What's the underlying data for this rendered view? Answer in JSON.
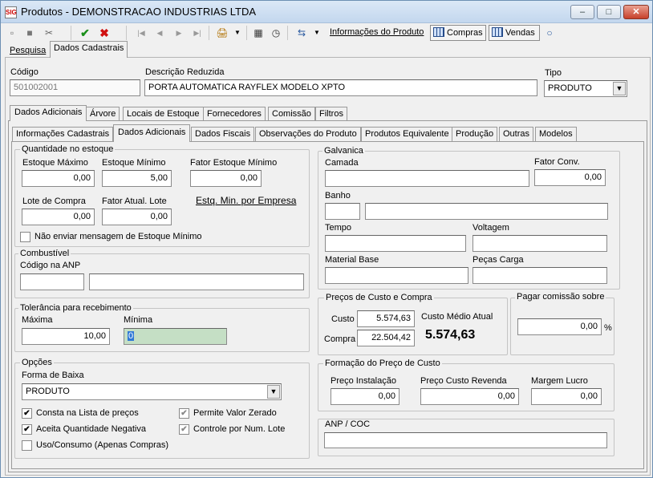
{
  "window": {
    "title": "Produtos - DEMONSTRACAO INDUSTRIAS LTDA",
    "icon_text": "SIG",
    "min": "–",
    "max": "□",
    "close": "✕"
  },
  "toolbar": {
    "icons": [
      "new-icon",
      "save-icon",
      "delete-icon",
      "confirm-icon",
      "cancel-icon",
      "first-icon",
      "prev-icon",
      "next-icon",
      "last-icon",
      "print-icon",
      "calculator-icon",
      "history-icon",
      "export-icon",
      "status-circle-icon"
    ],
    "glyphs": {
      "new": "▫",
      "save": "■",
      "delete": "✂",
      "confirm": "✔",
      "cancel": "✖",
      "first": "|◀",
      "prev": "◀",
      "next": "▶",
      "last": "▶|",
      "print": "🖨",
      "dropdown": "▼",
      "calc": "▦",
      "history": "◷",
      "export": "⇆",
      "circle": "○"
    },
    "info_link": "Informações do Produto",
    "compras": "Compras",
    "vendas": "Vendas",
    "colors": {
      "confirm": "#1a8f1a",
      "cancel": "#d01010"
    }
  },
  "top_tabs": [
    "Pesquisa",
    "Dados Cadastrais"
  ],
  "header": {
    "codigo_label": "Código",
    "codigo_value": "501002001",
    "descricao_label": "Descrição Reduzida",
    "descricao_value": "PORTA AUTOMATICA RAYFLEX MODELO XPTO",
    "tipo_label": "Tipo",
    "tipo_value": "PRODUTO"
  },
  "section_tabs": [
    "Dados Adicionais",
    "Árvore",
    "Locais de Estoque",
    "Fornecedores",
    "Comissão",
    "Filtros"
  ],
  "sub_tabs": [
    "Informações Cadastrais",
    "Dados Adicionais",
    "Dados Fiscais",
    "Observações do Produto",
    "Produtos Equivalente",
    "Produção",
    "Outras",
    "Modelos"
  ],
  "estoque": {
    "title": "Quantidade no estoque",
    "max_label": "Estoque Máximo",
    "max_value": "0,00",
    "min_label": "Estoque Mínimo",
    "min_value": "5,00",
    "fator_min_label": "Fator Estoque Mínimo",
    "fator_min_value": "0,00",
    "lote_label": "Lote de Compra",
    "lote_value": "0,00",
    "fator_lote_label": "Fator Atual. Lote",
    "fator_lote_value": "0,00",
    "empresa_link": "Estq. Min. por Empresa",
    "nao_enviar_label": "Não enviar mensagem de Estoque Mínimo"
  },
  "combustivel": {
    "title": "Combustível",
    "anp_label": "Código na ANP",
    "anp_value": "",
    "anp_desc": ""
  },
  "tolerancia": {
    "title": "Tolerância para recebimento",
    "max_label": "Máxima",
    "max_value": "10,00",
    "min_label": "Mínima",
    "min_value": "0"
  },
  "opcoes": {
    "title": "Opções",
    "forma_label": "Forma de Baixa",
    "forma_value": "PRODUTO",
    "consta_label": "Consta na Lista de preços",
    "aceita_label": "Aceita Quantidade Negativa",
    "uso_label": "Uso/Consumo (Apenas Compras)",
    "permite_label": "Permite Valor Zerado",
    "controle_label": "Controle por Num. Lote",
    "check_mark": "✔"
  },
  "galvanica": {
    "title": "Galvanica",
    "camada_label": "Camada",
    "fator_conv_label": "Fator Conv.",
    "fator_conv_value": "0,00",
    "banho_label": "Banho",
    "tempo_label": "Tempo",
    "voltagem_label": "Voltagem",
    "material_label": "Material Base",
    "pecas_label": "Peças Carga"
  },
  "precos": {
    "title": "Preços de Custo e Compra",
    "custo_label": "Custo",
    "custo_value": "5.574,63",
    "compra_label": "Compra",
    "compra_value": "22.504,42",
    "medio_label": "Custo Médio Atual",
    "medio_value": "5.574,63"
  },
  "comissao": {
    "title": "Pagar comissão sobre",
    "value": "0,00",
    "unit": "%"
  },
  "formacao": {
    "title": "Formação do Preço de Custo",
    "instalacao_label": "Preço Instalação",
    "instalacao_value": "0,00",
    "revenda_label": "Preço Custo Revenda",
    "revenda_value": "0,00",
    "margem_label": "Margem Lucro",
    "margem_value": "0,00"
  },
  "anp_coc": {
    "title": "ANP / COC",
    "value": ""
  }
}
